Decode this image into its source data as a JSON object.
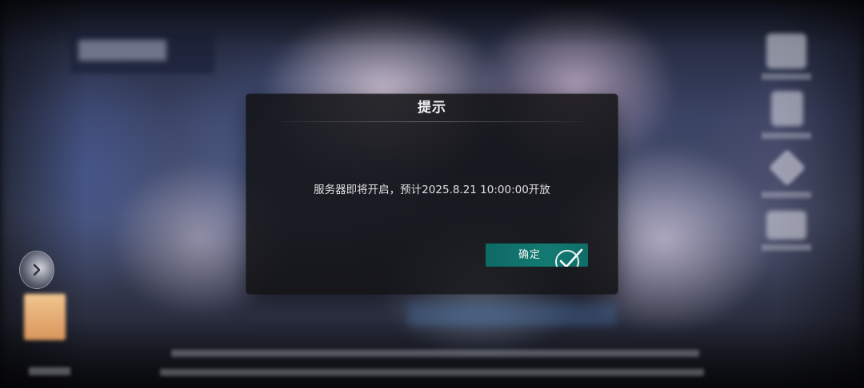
{
  "dialog": {
    "title": "提示",
    "message": "服务器即将开启，预计2025.8.21 10:00:00开放",
    "confirm_label": "确定"
  },
  "colors": {
    "confirm_button": "#127a72",
    "dialog_background": "#121214"
  },
  "icons": {
    "confirm": "check-icon",
    "side_arrow": "chevron-right-icon"
  }
}
